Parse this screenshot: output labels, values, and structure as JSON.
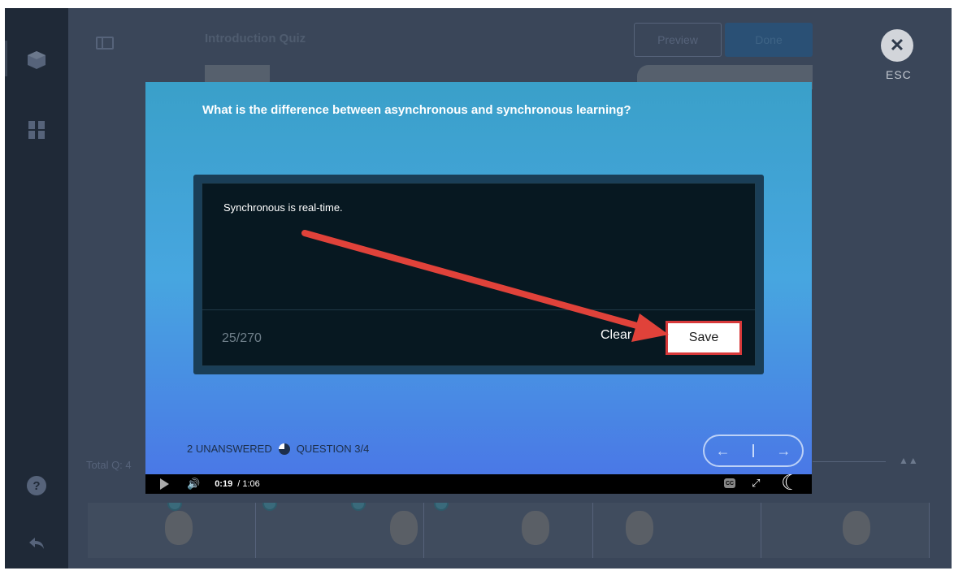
{
  "editor": {
    "title": "Introduction Quiz",
    "preview_label": "Preview",
    "done_label": "Done",
    "total_questions_label": "Total Q: 4"
  },
  "close": {
    "icon": "close-icon",
    "esc_label": "ESC"
  },
  "quiz": {
    "question": "What is the difference between asynchronous and synchronous learning?",
    "answer_text": "Synchronous is real-time.",
    "char_count": "25/270",
    "clear_label": "Clear",
    "save_label": "Save",
    "unanswered_label": "2 UNANSWERED",
    "question_progress": "QUESTION 3/4",
    "question_progress_fraction": 0.75
  },
  "player": {
    "current_time": "0:19",
    "total_time": "/ 1:06"
  },
  "colors": {
    "highlight_red": "#d7393a",
    "modal_top": "#3aa0c9",
    "modal_bottom": "#4a78e6"
  }
}
